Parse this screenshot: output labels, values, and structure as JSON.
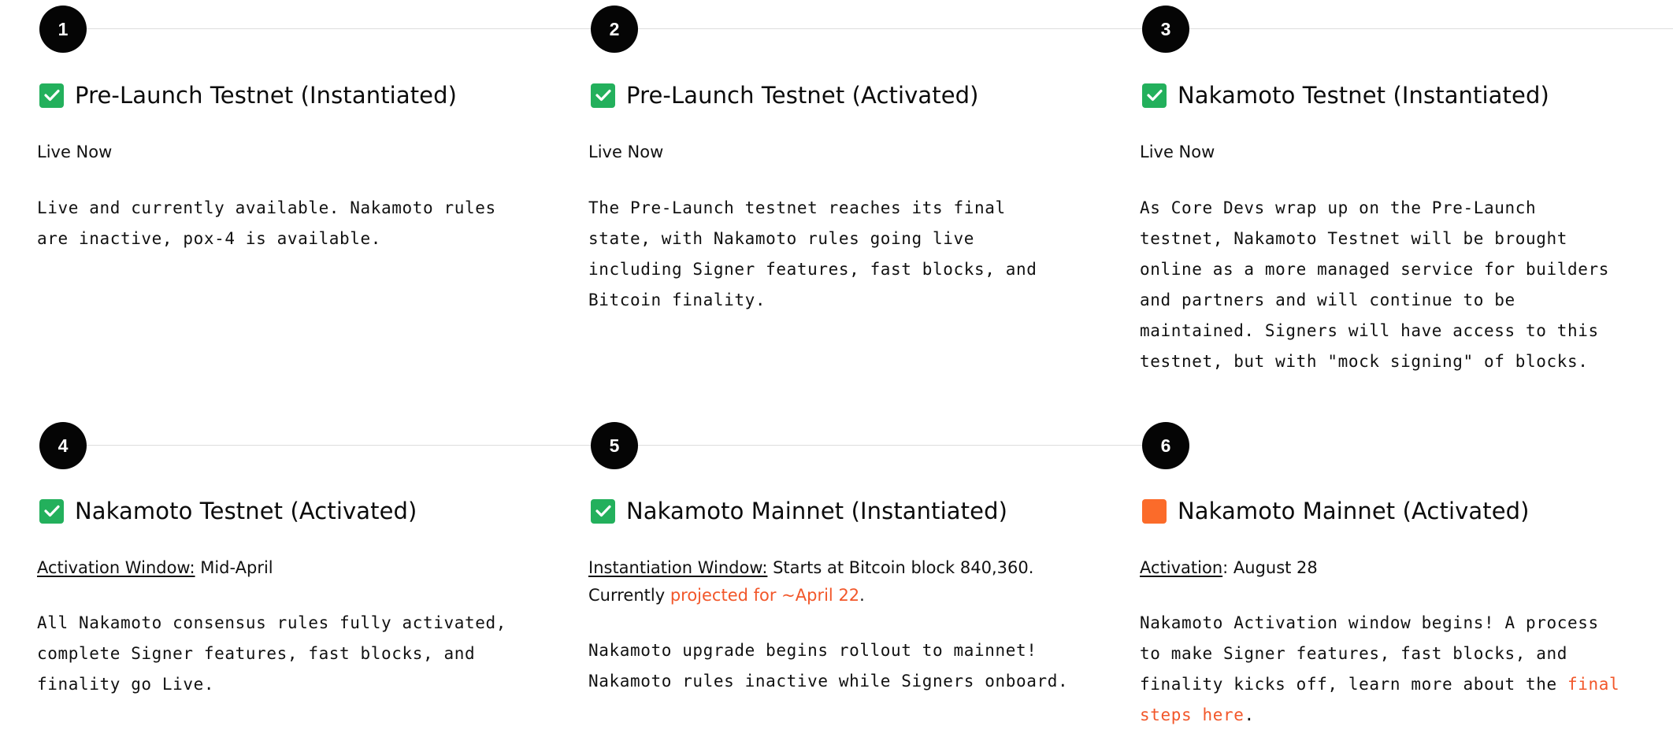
{
  "steps": [
    {
      "number": "1",
      "status": "complete",
      "title": "Pre-Launch Testnet (Instantiated)",
      "meta_text": "Live Now",
      "description_lines": [
        "Live and currently available. Nakamoto rules",
        "are inactive, pox-4 is available."
      ]
    },
    {
      "number": "2",
      "status": "complete",
      "title": "Pre-Launch Testnet (Activated)",
      "meta_text": "Live Now",
      "description_lines": [
        "The Pre-Launch testnet reaches its final",
        "state, with Nakamoto rules going live",
        "including Signer features, fast blocks, and",
        "Bitcoin finality."
      ]
    },
    {
      "number": "3",
      "status": "complete",
      "title": "Nakamoto Testnet (Instantiated)",
      "meta_text": "Live Now",
      "description_lines": [
        "As Core Devs wrap up on the Pre-Launch",
        "testnet, Nakamoto Testnet will be brought",
        "online as a more managed service for builders",
        "and partners and will continue to be",
        "maintained. Signers will have access to this",
        "testnet, but with \"mock signing\" of blocks."
      ]
    },
    {
      "number": "4",
      "status": "complete",
      "title": "Nakamoto Testnet (Activated)",
      "meta_label": "Activation Window:",
      "meta_value": " Mid-April",
      "description_lines": [
        "All Nakamoto consensus rules fully activated,",
        "complete Signer features, fast blocks, and",
        "finality go Live."
      ]
    },
    {
      "number": "5",
      "status": "complete",
      "title": "Nakamoto Mainnet (Instantiated)",
      "meta_label": "Instantiation Window:",
      "meta_value": " Starts at Bitcoin block 840,360.",
      "meta_line2_prefix": "Currently ",
      "meta_line2_link": "projected for ~April 22",
      "meta_line2_suffix": ".",
      "description_lines": [
        "Nakamoto upgrade begins rollout to mainnet!",
        "Nakamoto rules inactive while Signers onboard."
      ]
    },
    {
      "number": "6",
      "status": "pending",
      "title": "Nakamoto Mainnet (Activated)",
      "meta_label": "Activation",
      "meta_value": ": August 28",
      "description_lines": [
        "Nakamoto Activation window begins! A process",
        "to make Signer features, fast blocks, and"
      ],
      "description_line3_prefix": "finality kicks off, learn more about the ",
      "description_line3_link": "final",
      "description_line4_link": "steps here",
      "description_line4_suffix": "."
    }
  ],
  "colors": {
    "complete": "#23b05c",
    "pending": "#fb6b2a",
    "accent_link": "#f2572a",
    "badge": "#050505",
    "connector": "#dedede"
  },
  "icons": {
    "complete": "checkmark-icon",
    "pending": "pending-square-icon"
  }
}
